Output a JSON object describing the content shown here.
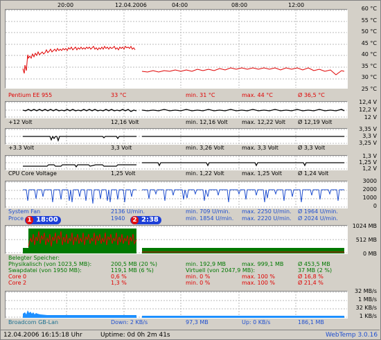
{
  "time_axis": [
    "20:00",
    "12.04.2006",
    "04:00",
    "08:00",
    "12:00"
  ],
  "temp": {
    "axis": [
      "60 °C",
      "55 °C",
      "50 °C",
      "45 °C",
      "40 °C",
      "35 °C",
      "30 °C",
      "25 °C"
    ],
    "name": "Pentium EE 955",
    "current": "33 °C",
    "min": "min. 31 °C",
    "max": "max. 44 °C",
    "avg": "Ø 36,5 °C"
  },
  "v12": {
    "axis": [
      "12,4 V",
      "12,2 V",
      "12 V"
    ],
    "name": "+12 Volt",
    "current": "12,16 Volt",
    "min": "min. 12,16 Volt",
    "max": "max. 12,22 Volt",
    "avg": "Ø 12,19 Volt"
  },
  "v33": {
    "axis": [
      "3,35 V",
      "3,3 V",
      "3,25 V"
    ],
    "name": "+3.3 Volt",
    "current": "3,3 Volt",
    "min": "min. 3,26 Volt",
    "max": "max. 3,3 Volt",
    "avg": "Ø 3,3 Volt"
  },
  "vcore": {
    "axis": [
      "1,3 V",
      "1,25 V",
      "1,2 V"
    ],
    "name": "CPU Core Voltage",
    "current": "1,25 Volt",
    "min": "min. 1,22 Volt",
    "max": "max. 1,25 Volt",
    "avg": "Ø 1,24 Volt"
  },
  "fan": {
    "axis": [
      "3000",
      "2000",
      "1000",
      "0"
    ],
    "row1": {
      "name": "System Fan",
      "current": "2136 U/min.",
      "min": "min. 709 U/min.",
      "max": "max. 2250 U/min.",
      "avg": "Ø 1964 U/min."
    },
    "row2": {
      "name": "Proce",
      "current": "1940",
      "min": "min. 1854 U/min.",
      "max": "max. 2220 U/min.",
      "avg": "Ø 2024 U/min."
    }
  },
  "badges": [
    {
      "num": "1",
      "time": "18:00"
    },
    {
      "num": "2",
      "time": "2:38"
    }
  ],
  "mem": {
    "axis": [
      "1024 MB",
      "512 MB",
      "0 MB"
    ],
    "title": "Belegter Speicher:",
    "rows": [
      {
        "a": "Physikalisch (von 1023,5 MB):",
        "b": "200,5 MB (20 %)",
        "c": "min. 192,9 MB",
        "d": "max. 999,1 MB",
        "e": "Ø 453,5 MB"
      },
      {
        "a": "Swapdatei (von 1950 MB):",
        "b": "119,1 MB (6 %)",
        "c": "Virtuell (von 2047,9 MB):",
        "d": "",
        "e": "37 MB (2 %)"
      },
      {
        "a": "Core 0",
        "b": "0,6 %",
        "c": "min. 0 %",
        "d": "max. 100 %",
        "e": "Ø 16,8 %"
      },
      {
        "a": "Core 2",
        "b": "1,3 %",
        "c": "min. 0 %",
        "d": "max. 100 %",
        "e": "Ø 21,4 %"
      }
    ]
  },
  "net": {
    "axis": [
      "32 MB/s",
      "1 MB/s",
      "32 KB/s",
      "1 KB/s"
    ],
    "name": "Broadcom GB-Lan",
    "down": "Down: 2 KB/s",
    "down_total": "97,3 MB",
    "up": "Up: 0 KB/s",
    "up_total": "186,1 MB"
  },
  "status": {
    "datetime": "12.04.2006 16:15:18 Uhr",
    "uptime": "Uptime: 0d 0h 2m 41s",
    "app": "WebTemp 3.0.16"
  },
  "colors": {
    "bg": "#d4d0c8",
    "temp_line": "#e00000",
    "fan_line": "#1f4fd0",
    "mem_fill": "#007800",
    "net_fill": "#1e90ff"
  }
}
